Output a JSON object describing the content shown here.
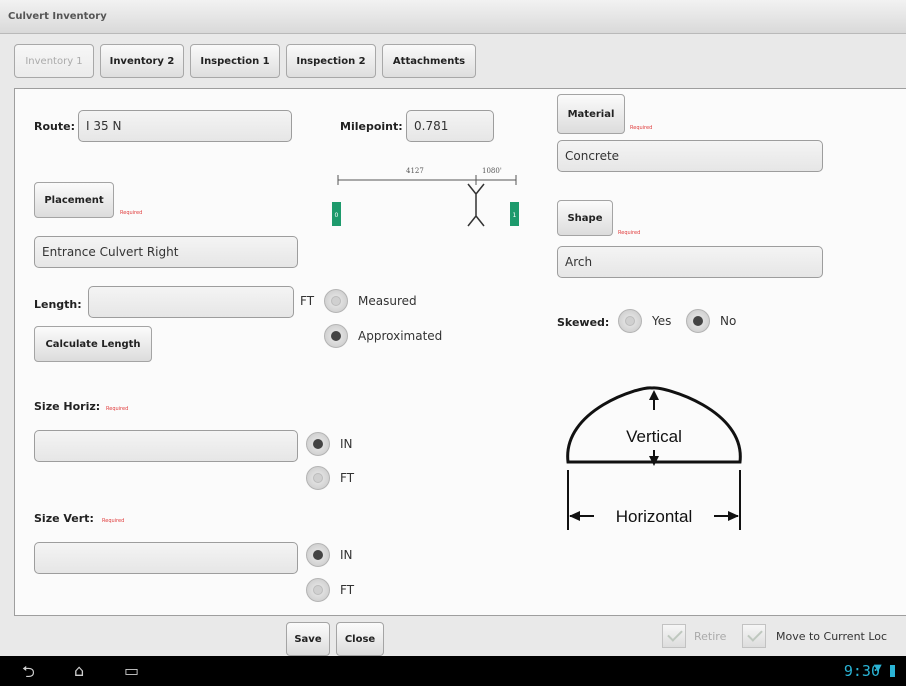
{
  "window": {
    "title": "Culvert Inventory"
  },
  "tabs": [
    {
      "label": "Inventory 1",
      "active": true
    },
    {
      "label": "Inventory 2"
    },
    {
      "label": "Inspection 1"
    },
    {
      "label": "Inspection 2"
    },
    {
      "label": "Attachments"
    }
  ],
  "form": {
    "route_label": "Route:",
    "route_value": "I 35 N",
    "milepoint_label": "Milepoint:",
    "milepoint_value": "0.781",
    "placement_button": "Placement",
    "placement_required": "Required",
    "placement_value": "Entrance Culvert Right",
    "length_label": "Length:",
    "length_value": "",
    "length_unit": "FT",
    "measured_label": "Measured",
    "approximated_label": "Approximated",
    "length_method_selected": "Approximated",
    "calculate_length_button": "Calculate Length",
    "size_horiz_label": "Size Horiz:",
    "size_horiz_required": "Required",
    "size_horiz_value": "",
    "size_horiz_unit_in": "IN",
    "size_horiz_unit_ft": "FT",
    "size_horiz_unit_selected": "IN",
    "size_vert_label": "Size Vert:",
    "size_vert_required": "Required",
    "size_vert_value": "",
    "size_vert_unit_in": "IN",
    "size_vert_unit_ft": "FT",
    "size_vert_unit_selected": "IN",
    "material_button": "Material",
    "material_required": "Required",
    "material_value": "Concrete",
    "shape_button": "Shape",
    "shape_required": "Required",
    "shape_value": "Arch",
    "skewed_label": "Skewed:",
    "skewed_yes": "Yes",
    "skewed_no": "No",
    "skewed_selected": "No"
  },
  "diagram": {
    "left_distance": "4127",
    "right_distance": "1080'",
    "left_marker": "0",
    "right_marker": "1",
    "marker_color": "#1d9a6c"
  },
  "shape_diagram": {
    "vertical_label": "Vertical",
    "horizontal_label": "Horizontal"
  },
  "footer": {
    "save_button": "Save",
    "close_button": "Close",
    "retire_label": "Retire",
    "move_label": "Move to Current Loc"
  },
  "system": {
    "time": "9:30"
  }
}
